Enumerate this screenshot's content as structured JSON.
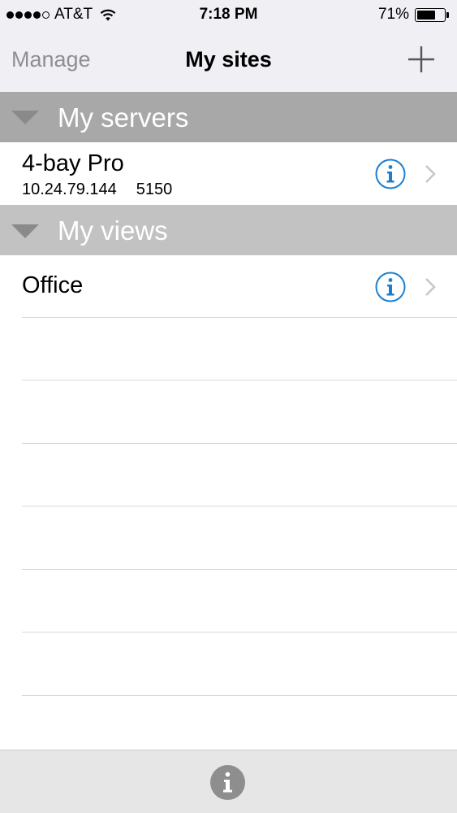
{
  "status_bar": {
    "carrier": "AT&T",
    "time": "7:18 PM",
    "battery_percent": "71%",
    "battery_level": 0.71,
    "signal_bars_filled": 4,
    "signal_bars_total": 5
  },
  "nav": {
    "left_label": "Manage",
    "title": "My sites",
    "add_icon": "plus-icon"
  },
  "sections": {
    "servers": {
      "label": "My servers",
      "items": [
        {
          "name": "4-bay Pro",
          "address": "10.24.79.144",
          "port": "5150"
        }
      ]
    },
    "views": {
      "label": "My views",
      "items": [
        {
          "name": "Office"
        }
      ]
    }
  },
  "colors": {
    "accent_blue": "#1a7fd0",
    "section_servers_bg": "#a8a8a8",
    "section_views_bg": "#c2c2c2",
    "toolbar_bg": "#e6e6e6"
  },
  "toolbar": {
    "info_icon": "info-icon"
  }
}
